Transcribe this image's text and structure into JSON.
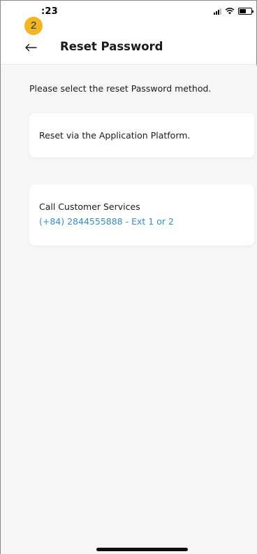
{
  "status_bar": {
    "time": ":23",
    "step_badge": "2"
  },
  "header": {
    "title": "Reset Password",
    "back_icon": "arrow-left-icon"
  },
  "main": {
    "instruction": "Please select the reset Password method.",
    "options": [
      {
        "title": "Reset via the Application Platform."
      },
      {
        "title": "Call Customer Services",
        "phone": "(+84) 2844555888 - Ext 1 or 2"
      }
    ]
  },
  "colors": {
    "accent_link": "#2f8fd8",
    "badge": "#f3b61f",
    "background": "#f6f6f6"
  }
}
